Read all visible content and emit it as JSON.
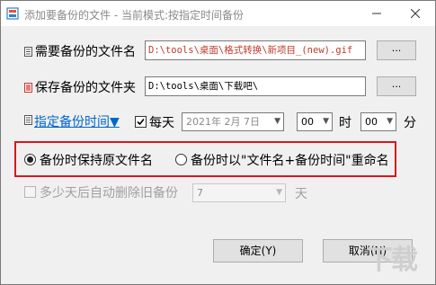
{
  "window": {
    "title": "添加要备份的文件 - 当前模式:按指定时间备份"
  },
  "source": {
    "label": "需要备份的文件名",
    "value": "D:\\tools\\桌面\\格式转换\\新项目_(new).gif",
    "value_color": "#c0392b",
    "browse_label": "..."
  },
  "dest": {
    "label": "保存备份的文件夹",
    "value": "D:\\tools\\桌面\\下载吧\\",
    "browse_label": "..."
  },
  "schedule": {
    "link_label": "指定备份时间▼",
    "daily_label": "每天",
    "daily_checked": true,
    "date_value": "2021年 2月 7日",
    "hour_value": "00",
    "hour_unit": "时",
    "minute_value": "00",
    "minute_unit": "分"
  },
  "naming": {
    "option_keep": "备份时保持原文件名",
    "option_rename": "备份时以\"文件名+备份时间\"重命名",
    "selected": "keep"
  },
  "auto_delete": {
    "label": "多少天后自动删除旧备份",
    "value": "7",
    "unit": "天",
    "enabled": false
  },
  "buttons": {
    "ok": "确定(Y)",
    "cancel": "取消(N)"
  },
  "colors": {
    "accent_red": "#d9161e",
    "link_blue": "#0066cc"
  },
  "icons": {
    "app": "app-icon",
    "source": "file-icon",
    "dest": "folder-icon",
    "schedule": "clock-icon"
  }
}
